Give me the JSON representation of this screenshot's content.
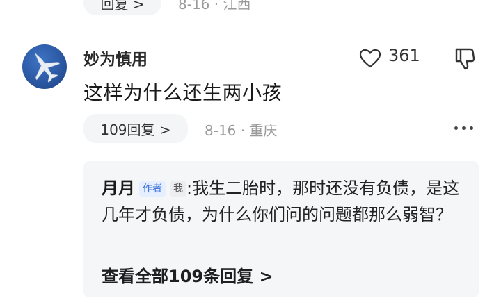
{
  "previous_comment": {
    "reply_label": "回复 >",
    "meta": "8-16 · 江西"
  },
  "comment": {
    "username": "妙为慎用",
    "like_count": "361",
    "text": "这样为什么还生两小孩",
    "reply_button_label": "109回复 >",
    "meta": "8-16 · 重庆"
  },
  "reply": {
    "author": "月月",
    "author_tag": "作者",
    "me_tag": "我",
    "separator": ":",
    "text": "我生二胎时，那时还没有负债，是这几年才负债，为什么你们问的问题都那么弱智？",
    "view_all_label": "查看全部109条回复 >"
  },
  "icons": {
    "avatar": "fighter-jet-avatar",
    "like": "heart-outline-icon",
    "dislike": "thumbs-down-outline-icon",
    "more": "more-dots-icon"
  },
  "colors": {
    "accent_tag": "#3a72d8",
    "avatar_bg": "#2a56a0",
    "muted_text": "#9a9a9a",
    "reply_bg": "#f5f6f7"
  }
}
